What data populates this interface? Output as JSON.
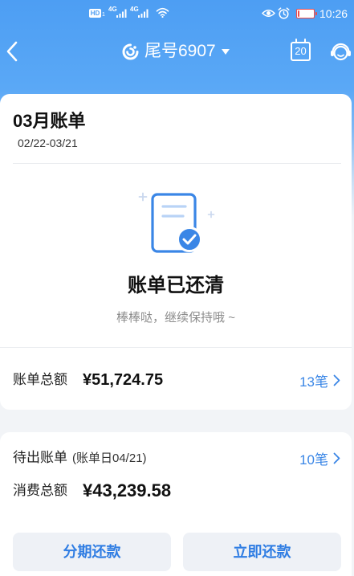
{
  "status_bar": {
    "hd_label": "HD",
    "sim_label": "1",
    "network_1": "4G",
    "network_2": "4G",
    "time": "10:26",
    "battery_level": 0.12
  },
  "header": {
    "title": "尾号6907",
    "calendar_day": "20"
  },
  "bill": {
    "title": "03月账单",
    "period": "02/22-03/21",
    "status_title": "账单已还清",
    "status_subtitle": "棒棒哒，继续保持哦 ~",
    "total_label": "账单总额",
    "total_amount": "¥51,724.75",
    "total_count": "13笔"
  },
  "pending": {
    "label": "待出账单",
    "bill_date": "(账单日04/21)",
    "count": "10笔",
    "spend_label": "消费总额",
    "spend_amount": "¥43,239.58"
  },
  "actions": {
    "installment_label": "分期还款",
    "repay_label": "立即还款"
  },
  "colors": {
    "brand_blue": "#3a86e6",
    "header_blue": "#4d9ef3",
    "button_bg": "#eef1f6",
    "button_text": "#2f7de3",
    "battery_low": "#ee4b4b"
  },
  "icons": {
    "back": "chevron-left-icon",
    "bank_logo": "bank-logo-icon",
    "dropdown": "dropdown-triangle-icon",
    "calendar": "calendar-icon",
    "customer_service": "customer-service-icon",
    "bill_status": "document-check-icon",
    "row_arrow": "chevron-right-icon",
    "status": [
      "wifi-icon",
      "signal-bars-icon",
      "eye-icon",
      "alarm-icon",
      "battery-icon"
    ]
  }
}
